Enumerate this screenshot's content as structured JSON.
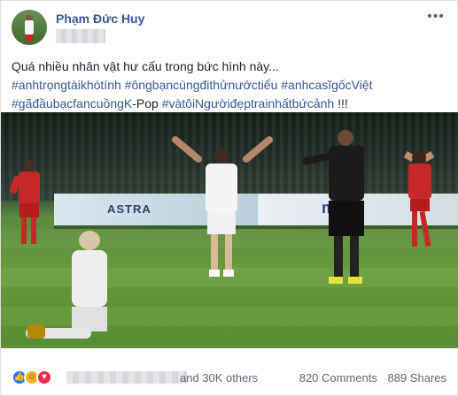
{
  "post": {
    "author": "Phạm Đức Huy",
    "more_icon": "ellipsis-icon",
    "lines": [
      [
        {
          "text": "Quá nhiều nhân vật hư cấu trong bức hình này...",
          "tag": false
        }
      ],
      [
        {
          "text": "#anhtrọngtàikhótính",
          "tag": true
        },
        {
          "text": " ",
          "tag": false
        },
        {
          "text": "#ôngbạncùngđithửnướctiểu",
          "tag": true
        },
        {
          "text": " ",
          "tag": false
        },
        {
          "text": "#anhcasĩgốcViệt",
          "tag": true
        }
      ],
      [
        {
          "text": "#gãđầubạcfancuồngK",
          "tag": true
        },
        {
          "text": "-Pop ",
          "tag": false
        },
        {
          "text": "#vàtôiNgườiđẹptrainhấtbứcảnh",
          "tag": true
        },
        {
          "text": " !!!",
          "tag": false
        }
      ]
    ]
  },
  "photo": {
    "board_texts": [
      "ASTRA",
      "ma"
    ]
  },
  "footer": {
    "reaction_icons": [
      "like-icon",
      "haha-icon",
      "love-icon"
    ],
    "others_text": "and 30K others",
    "comments_text": "820 Comments",
    "shares_text": "889 Shares"
  },
  "colors": {
    "link": "#385898",
    "text": "#1d2129",
    "muted": "#606770",
    "like": "#2078f4",
    "love": "#f0284a",
    "haha": "#f7b125",
    "vietnam_red": "#c62828",
    "referee_black": "#1b1b1b"
  }
}
